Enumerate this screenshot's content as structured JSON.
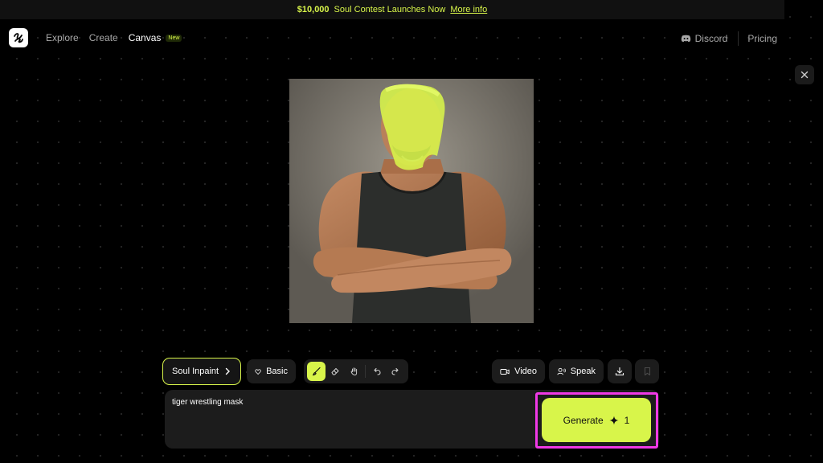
{
  "banner": {
    "prize": "$10,000",
    "text": "Soul Contest Launches Now",
    "link": "More info"
  },
  "nav": {
    "links": [
      "Explore",
      "Create",
      "Canvas"
    ],
    "new_badge": "New",
    "discord": "Discord",
    "pricing": "Pricing"
  },
  "toolbar": {
    "model_label": "Soul Inpaint",
    "style_label": "Basic",
    "video_label": "Video",
    "speak_label": "Speak"
  },
  "prompt": {
    "value": "tiger wrestling mask"
  },
  "generate": {
    "label": "Generate",
    "cost": "1"
  },
  "colors": {
    "accent": "#d8f54a",
    "highlight": "#f039e6",
    "panel": "#1c1c1c",
    "background": "#000000"
  },
  "icons": [
    "logo-icon",
    "discord-icon",
    "close-icon",
    "chevron-right-icon",
    "heart-icon",
    "brush-icon",
    "eraser-icon",
    "hand-icon",
    "undo-icon",
    "redo-icon",
    "video-icon",
    "speak-icon",
    "download-icon",
    "bookmark-icon",
    "sparkle-icon"
  ]
}
